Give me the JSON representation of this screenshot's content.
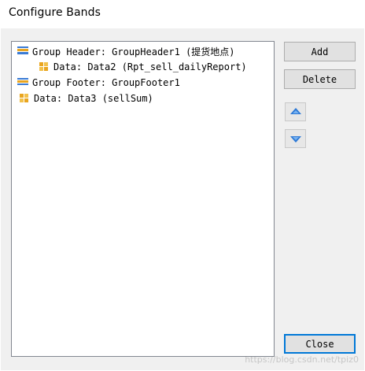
{
  "window": {
    "title": "Configure Bands"
  },
  "tree": {
    "items": [
      {
        "label": "Group Header: GroupHeader1 (提货地点)",
        "icon": "group-header-icon",
        "level": 0
      },
      {
        "label": "Data: Data2 (Rpt_sell_dailyReport)",
        "icon": "data-band-icon",
        "level": 1
      },
      {
        "label": "Group Footer: GroupFooter1",
        "icon": "group-footer-icon",
        "level": 0
      },
      {
        "label": "Data: Data3 (sellSum)",
        "icon": "data-band-icon",
        "level": 0
      }
    ]
  },
  "buttons": {
    "add": "Add",
    "delete": "Delete",
    "move_up_icon": "arrow-up-icon",
    "move_down_icon": "arrow-down-icon",
    "close": "Close"
  },
  "watermark": "https://blog.csdn.net/tpiz0"
}
